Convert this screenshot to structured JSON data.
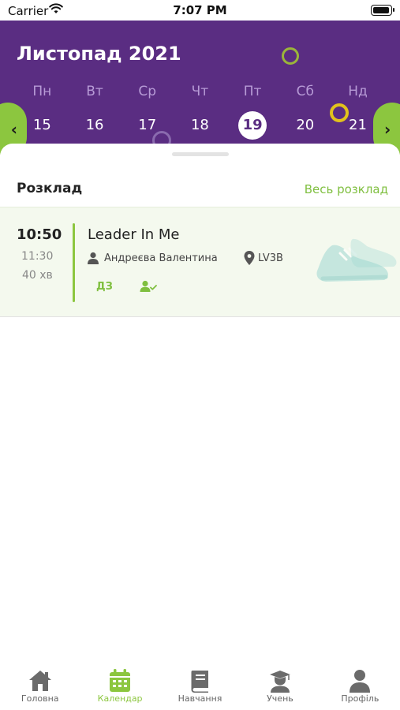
{
  "status_bar": {
    "carrier": "Carrier",
    "time": "7:07 PM",
    "battery_level": 1.0
  },
  "calendar": {
    "month_title": "Листопад 2021",
    "weekdays": [
      "Пн",
      "Вт",
      "Ср",
      "Чт",
      "Пт",
      "Сб",
      "Нд"
    ],
    "days": [
      "15",
      "16",
      "17",
      "18",
      "19",
      "20",
      "21"
    ],
    "selected_day": "19",
    "prev_icon": "chevron-left-icon",
    "next_icon": "chevron-right-icon",
    "accent_color": "#8cc63f",
    "header_color": "#5a2d82"
  },
  "schedule": {
    "title": "Розклад",
    "see_all_label": "Весь розклад",
    "lessons": [
      {
        "start_time": "10:50",
        "end_time": "11:30",
        "duration": "40 хв",
        "subject": "Leader In Me",
        "teacher": "Андреєва Валентина",
        "room": "LV3B",
        "homework_label": "ДЗ",
        "attendance_icon": "user-check-icon",
        "illustration": "sneaker-icon"
      }
    ]
  },
  "tabbar": {
    "items": [
      {
        "label": "Головна",
        "icon": "home-icon",
        "active": false
      },
      {
        "label": "Календар",
        "icon": "calendar-icon",
        "active": true
      },
      {
        "label": "Навчання",
        "icon": "book-icon",
        "active": false
      },
      {
        "label": "Учень",
        "icon": "student-icon",
        "active": false
      },
      {
        "label": "Профіль",
        "icon": "profile-icon",
        "active": false
      }
    ]
  }
}
